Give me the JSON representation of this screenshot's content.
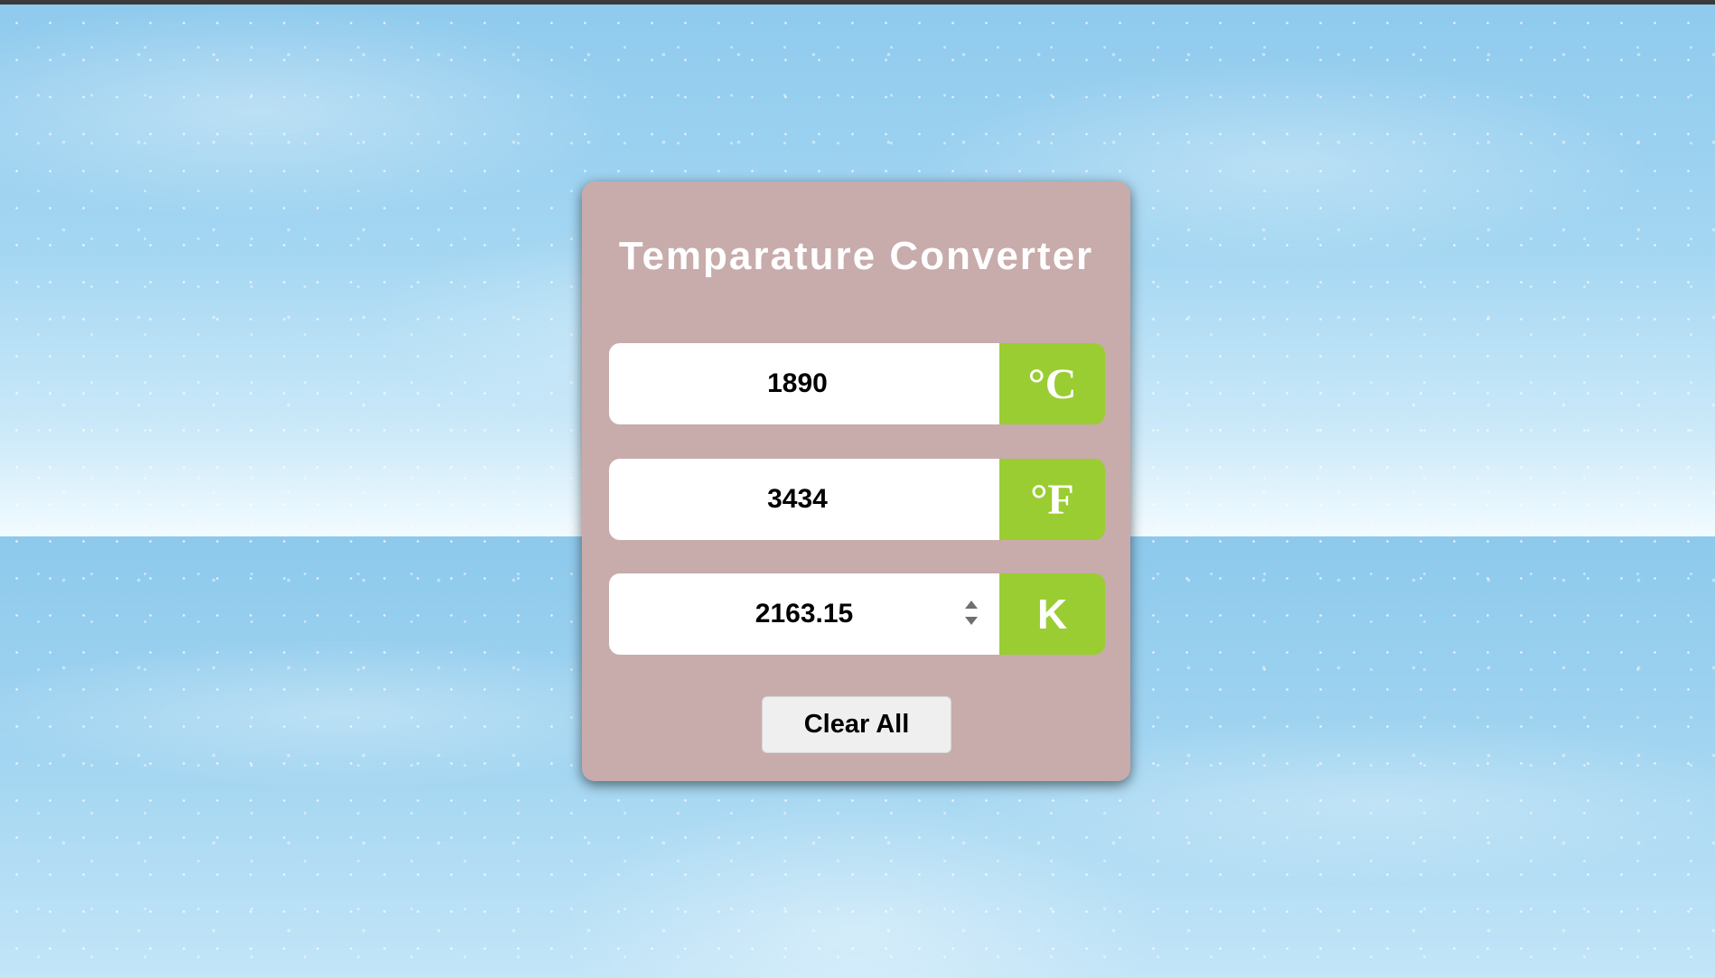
{
  "app": {
    "title": "Temparature Converter"
  },
  "fields": {
    "celsius": {
      "value": "1890",
      "unit_label": "°C"
    },
    "fahrenheit": {
      "value": "3434",
      "unit_label": "°F"
    },
    "kelvin": {
      "value": "2163.15",
      "unit_label": "K"
    }
  },
  "actions": {
    "clear_label": "Clear All"
  },
  "colors": {
    "card_background": "#c8abab",
    "unit_background": "#9acd32",
    "title_text": "#ffffff",
    "page_background": "#9fd3ef"
  },
  "icons": {
    "kelvin_spinner": "number-spinner-icon"
  }
}
